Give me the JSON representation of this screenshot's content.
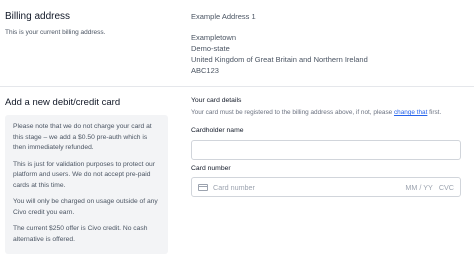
{
  "billing": {
    "heading": "Billing address",
    "subtitle": "This is your current billing address.",
    "address_lines": [
      "Example Address 1",
      "Exampletown",
      "Demo-state",
      "United Kingdom of Great Britain and Northern Ireland",
      "ABC123"
    ]
  },
  "card_section": {
    "heading": "Add a new debit/credit card",
    "notices": [
      "Please note that we do not charge your card at this stage – we add a $0.50 pre-auth which is then immediately refunded.",
      "This is just for validation purposes to protect our platform and users. We do not accept pre-paid cards at this time.",
      "You will only be charged on usage outside of any Civo credit you earn.",
      "The current $250 offer is Civo credit. No cash alternative is offered."
    ]
  },
  "card_details": {
    "label": "Your card details",
    "note_before": "Your card must be registered to the billing address above, if not, please ",
    "note_link": "change that",
    "note_after": " first.",
    "cardholder_label": "Cardholder name",
    "cardholder_value": "",
    "card_number_label": "Card number",
    "card_number_placeholder": "Card number",
    "expiry_placeholder": "MM / YY",
    "cvc_placeholder": "CVC"
  }
}
